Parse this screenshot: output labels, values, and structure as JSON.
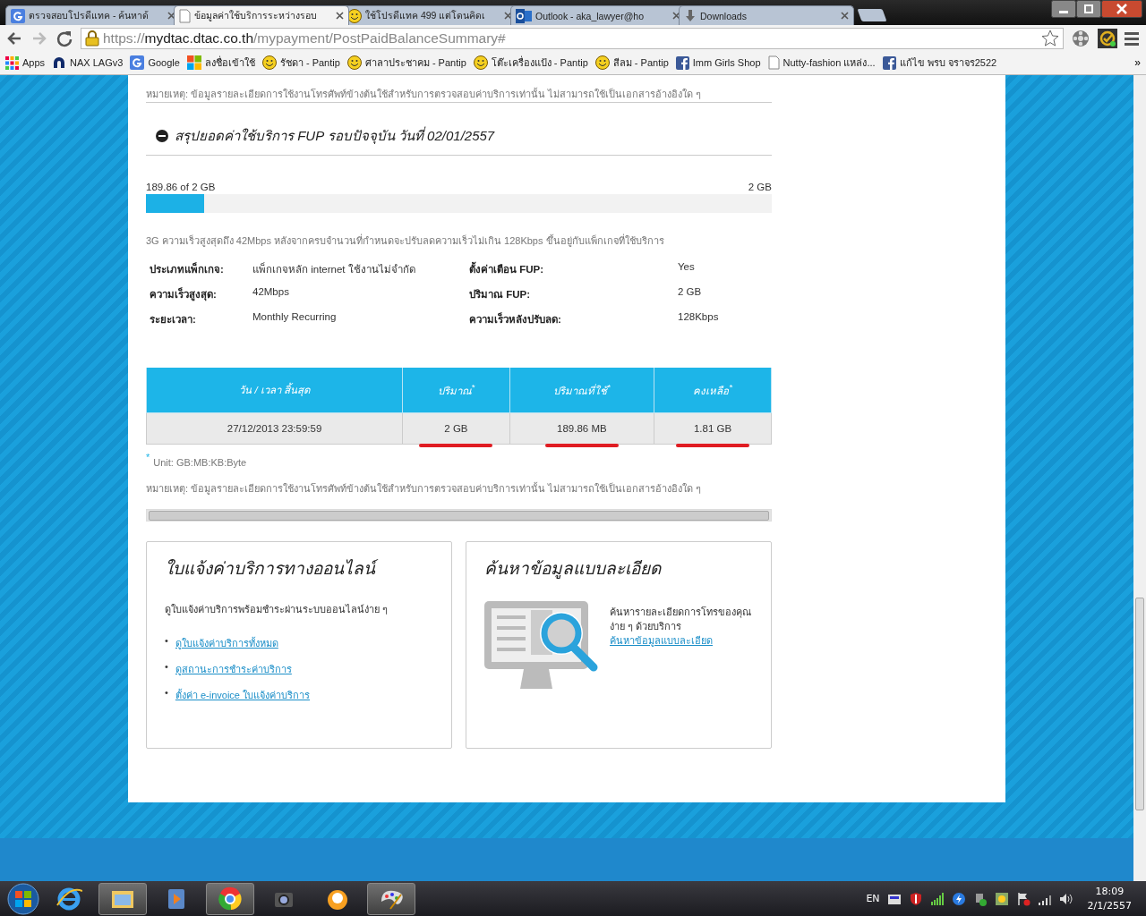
{
  "browser": {
    "tabs": [
      {
        "title": "ตรวจสอบโปรดีแทค - ค้นหาด้",
        "kind": "letter-tile",
        "selected": false
      },
      {
        "title": "ข้อมูลค่าใช้บริการระหว่างรอบ",
        "kind": "page",
        "selected": true
      },
      {
        "title": "ใช้โปรดีแทค 499 แต่โดนคิดเ",
        "kind": "smiley",
        "selected": false
      },
      {
        "title": "Outlook - aka_lawyer@ho",
        "kind": "mail",
        "selected": false
      },
      {
        "title": "Downloads",
        "kind": "download",
        "selected": false
      }
    ],
    "address": {
      "scheme": "https://",
      "host": "mydtac.dtac.co.th",
      "path": "/mypayment/PostPaidBalanceSummary#"
    },
    "bookmarks": [
      {
        "label": "Apps",
        "kind": "grid"
      },
      {
        "label": "NAX LAGv3",
        "kind": "arch"
      },
      {
        "label": "Google",
        "kind": "letter-tile"
      },
      {
        "label": "ลงชื่อเข้าใช้",
        "kind": "squares"
      },
      {
        "label": "รัชดา - Pantip",
        "kind": "smiley"
      },
      {
        "label": "ศาลาประชาคม - Pantip",
        "kind": "smiley"
      },
      {
        "label": "โต๊ะเครื่องแป้ง - Pantip",
        "kind": "smiley"
      },
      {
        "label": "สีลม - Pantip",
        "kind": "smiley"
      },
      {
        "label": "Imm Girls Shop",
        "kind": "f-tile"
      },
      {
        "label": "Nutty-fashion แหล่ง...",
        "kind": "page"
      },
      {
        "label": "แก้ไข พรบ จราจร2522",
        "kind": "f-tile"
      }
    ],
    "more": "»"
  },
  "page": {
    "top_note": "หมายเหตุ: ข้อมูลรายละเอียดการใช้งานโทรศัพท์ข้างต้นใช้สำหรับการตรวจสอบค่าบริการเท่านั้น ไม่สามารถใช้เป็นเอกสารอ้างอิงใด ๆ",
    "section_title": "สรุปยอดค่าใช้บริการ FUP รอบปัจจุบัน วันที่ 02/01/2557",
    "expanded": true,
    "usage": {
      "label": "189.86 of 2 GB",
      "max": "2 GB",
      "level": 0.093
    },
    "description": "3G ความเร็วสูงสุดถึง 42Mbps หลังจากครบจำนวนที่กำหนดจะปรับลดความเร็วไม่เกิน 128Kbps ขึ้นอยู่กับแพ็กเกจที่ใช้บริการ",
    "details": [
      {
        "label": "ประเภทแพ็กเกจ:",
        "value": "แพ็กเกจหลัก internet ใช้งานไม่จำกัด",
        "label_2": "ตั้งค่าเตือน FUP:",
        "value_2": "Yes"
      },
      {
        "label": "ความเร็วสูงสุด:",
        "value": "42Mbps",
        "label_2": "ปริมาณ FUP:",
        "value_2": "2 GB"
      },
      {
        "label": "ระยะเวลา:",
        "value": "Monthly Recurring",
        "label_2": "ความเร็วหลังปรับลด:",
        "value_2": "128Kbps"
      }
    ],
    "table": {
      "columns": [
        "วัน / เวลา สิ้นสุด",
        "ปริมาณ$^{*}$",
        "ปริมาณที่ใช้$^{*}$",
        "คงเหลือ$^{*}$"
      ],
      "rows": [
        [
          {
            "text": "27/12/2013 23:59:59",
            "underlined": false
          },
          {
            "text": "2 GB",
            "underlined": true
          },
          {
            "text": "189.86 MB",
            "underlined": true
          },
          {
            "text": "1.81 GB",
            "underlined": true
          }
        ]
      ]
    },
    "unit_mark": "*",
    "unit": "Unit: GB:MB:KB:Byte",
    "bottom_note": "หมายเหตุ: ข้อมูลรายละเอียดการใช้งานโทรศัพท์ข้างต้นใช้สำหรับการตรวจสอบค่าบริการเท่านั้น ไม่สามารถใช้เป็นเอกสารอ้างอิงใด ๆ",
    "cards": [
      {
        "title": "ใบแจ้งค่าบริการทางออนไลน์",
        "text": "ดูใบแจ้งค่าบริการพร้อมชำระผ่านระบบออนไลน์ง่าย ๆ",
        "bullet": "•",
        "links": [
          "ดูใบแจ้งค่าบริการทั้งหมด",
          "ดูสถานะการชำระค่าบริการ",
          "ตั้งค่า e-invoice ใบแจ้งค่าบริการ"
        ]
      },
      {
        "title": "ค้นหาข้อมูลแบบละเอียด",
        "text": "ค้นหารายละเอียดการโทรของคุณง่าย ๆ ด้วยบริการ",
        "link": "ค้นหาข้อมูลแบบละเอียด"
      }
    ]
  },
  "taskbar": {
    "language": "EN",
    "time": "18:09",
    "date": "2/1/2557"
  }
}
